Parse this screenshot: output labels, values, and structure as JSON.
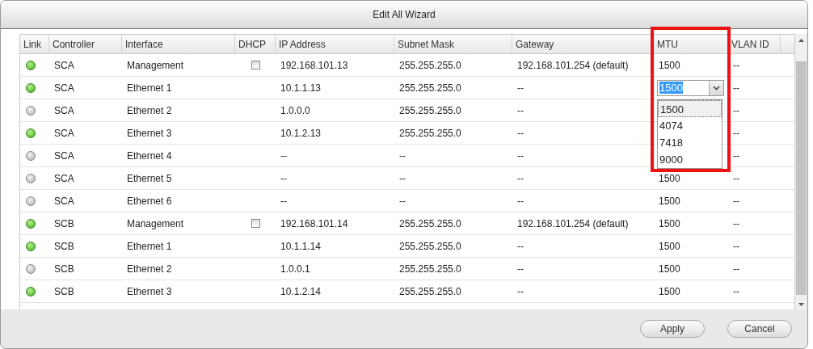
{
  "window": {
    "title": "Edit All Wizard"
  },
  "table": {
    "columns": [
      "Link",
      "Controller",
      "Interface",
      "DHCP",
      "IP Address",
      "Subnet Mask",
      "Gateway",
      "MTU",
      "VLAN ID"
    ],
    "rows": [
      {
        "link_up": true,
        "controller": "SCA",
        "interface": "Management",
        "dhcp": {
          "checked": false
        },
        "ip": "192.168.101.13",
        "subnet": "255.255.255.0",
        "gateway": "192.168.101.254 (default)",
        "mtu": {
          "kind": "text",
          "value": "1500"
        },
        "vlan": "--"
      },
      {
        "link_up": true,
        "controller": "SCA",
        "interface": "Ethernet 1",
        "ip": "10.1.1.13",
        "subnet": "255.255.255.0",
        "gateway": "--",
        "mtu": {
          "kind": "dropdown",
          "value": "1500",
          "options": [
            {
              "label": "1500",
              "selected": true
            },
            {
              "label": "4074",
              "selected": false
            },
            {
              "label": "7418",
              "selected": false
            },
            {
              "label": "9000",
              "selected": false
            }
          ]
        },
        "vlan": "--"
      },
      {
        "link_up": false,
        "controller": "SCA",
        "interface": "Ethernet 2",
        "ip": "1.0.0.0",
        "subnet": "255.255.255.0",
        "gateway": "--",
        "vlan": "--"
      },
      {
        "link_up": true,
        "controller": "SCA",
        "interface": "Ethernet 3",
        "ip": "10.1.2.13",
        "subnet": "255.255.255.0",
        "gateway": "--",
        "vlan": "--"
      },
      {
        "link_up": false,
        "controller": "SCA",
        "interface": "Ethernet 4",
        "ip": "--",
        "subnet": "--",
        "gateway": "--",
        "vlan": "--"
      },
      {
        "link_up": false,
        "controller": "SCA",
        "interface": "Ethernet 5",
        "ip": "--",
        "subnet": "--",
        "gateway": "--",
        "mtu": {
          "kind": "text",
          "value": "1500"
        },
        "vlan": "--"
      },
      {
        "link_up": false,
        "controller": "SCA",
        "interface": "Ethernet 6",
        "ip": "--",
        "subnet": "--",
        "gateway": "--",
        "mtu": {
          "kind": "text",
          "value": "1500"
        },
        "vlan": "--"
      },
      {
        "link_up": true,
        "controller": "SCB",
        "interface": "Management",
        "dhcp": {
          "checked": false
        },
        "ip": "192.168.101.14",
        "subnet": "255.255.255.0",
        "gateway": "192.168.101.254 (default)",
        "mtu": {
          "kind": "text",
          "value": "1500"
        },
        "vlan": "--"
      },
      {
        "link_up": true,
        "controller": "SCB",
        "interface": "Ethernet 1",
        "ip": "10.1.1.14",
        "subnet": "255.255.255.0",
        "gateway": "--",
        "mtu": {
          "kind": "text",
          "value": "1500"
        },
        "vlan": "--"
      },
      {
        "link_up": false,
        "controller": "SCB",
        "interface": "Ethernet 2",
        "ip": "1.0.0.1",
        "subnet": "255.255.255.0",
        "gateway": "--",
        "mtu": {
          "kind": "text",
          "value": "1500"
        },
        "vlan": "--"
      },
      {
        "link_up": true,
        "controller": "SCB",
        "interface": "Ethernet 3",
        "ip": "10.1.2.14",
        "subnet": "255.255.255.0",
        "gateway": "--",
        "mtu": {
          "kind": "text",
          "value": "1500"
        },
        "vlan": "--"
      }
    ]
  },
  "buttons": [
    "Apply",
    "Cancel"
  ]
}
